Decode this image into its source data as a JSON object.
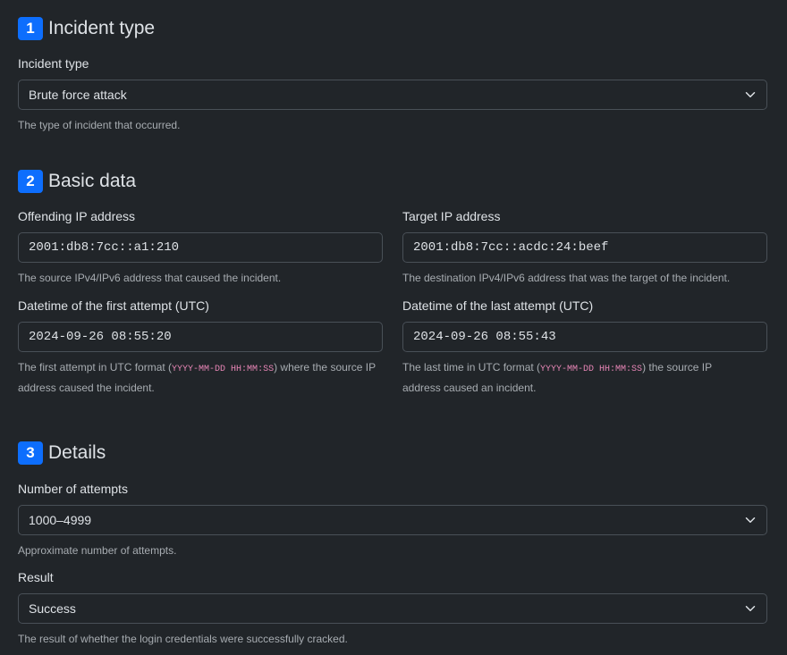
{
  "sections": [
    {
      "number": "1",
      "title": "Incident type"
    },
    {
      "number": "2",
      "title": "Basic data"
    },
    {
      "number": "3",
      "title": "Details"
    }
  ],
  "incident_type": {
    "label": "Incident type",
    "value": "Brute force attack",
    "help": "The type of incident that occurred."
  },
  "offending_ip": {
    "label": "Offending IP address",
    "value": "2001:db8:7cc::a1:210",
    "help": "The source IPv4/IPv6 address that caused the incident."
  },
  "target_ip": {
    "label": "Target IP address",
    "value": "2001:db8:7cc::acdc:24:beef",
    "help": "The destination IPv4/IPv6 address that was the target of the incident."
  },
  "first_attempt": {
    "label": "Datetime of the first attempt (UTC)",
    "value": "2024-09-26 08:55:20",
    "help_prefix": "The first attempt in UTC format (",
    "help_code": "YYYY-MM-DD HH:MM:SS",
    "help_suffix": ") where the source IP address caused the incident."
  },
  "last_attempt": {
    "label": "Datetime of the last attempt (UTC)",
    "value": "2024-09-26 08:55:43",
    "help_prefix": "The last time in UTC format (",
    "help_code": "YYYY-MM-DD HH:MM:SS",
    "help_suffix": ") the source IP address caused an incident."
  },
  "attempts": {
    "label": "Number of attempts",
    "value": "1000–4999",
    "help": "Approximate number of attempts."
  },
  "result": {
    "label": "Result",
    "value": "Success",
    "help": "The result of whether the login credentials were successfully cracked."
  },
  "icons": {
    "select_arrow": "chevron-down-icon"
  },
  "colors": {
    "background": "#212529",
    "badge": "#0d6efd",
    "border": "#495057",
    "code": "#e685b5"
  }
}
